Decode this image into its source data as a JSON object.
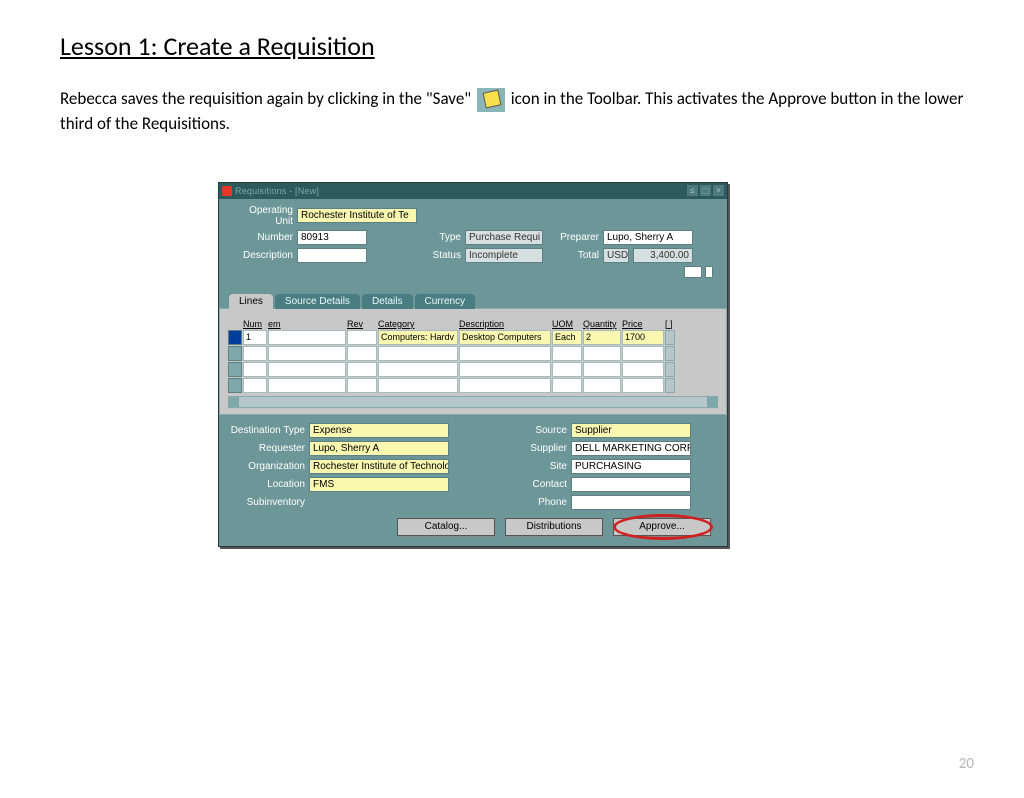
{
  "page": {
    "title": "Lesson 1:  Create a Requisition",
    "body_pre": "Rebecca saves the requisition again by clicking in the \"Save\" ",
    "body_post": " icon in the Toolbar.  This activates the Approve button in the lower third of the Requisitions.",
    "page_number": "20"
  },
  "window": {
    "title": "Requisitions - [New]"
  },
  "header": {
    "labels": {
      "operating_unit": "Operating Unit",
      "number": "Number",
      "description": "Description",
      "type": "Type",
      "status": "Status",
      "preparer": "Preparer",
      "total": "Total"
    },
    "operating_unit": "Rochester Institute of Te",
    "number": "80913",
    "description": "",
    "type": "Purchase Requi",
    "status": "Incomplete",
    "preparer": "Lupo, Sherry A",
    "currency": "USD",
    "total": "3,400.00"
  },
  "tabs": [
    "Lines",
    "Source Details",
    "Details",
    "Currency"
  ],
  "grid": {
    "headers": [
      "Num",
      "em",
      "Rev",
      "Category",
      "Description",
      "UOM",
      "Quantity",
      "Price"
    ],
    "row": {
      "num": "1",
      "em": "",
      "rev": "",
      "category": "Computers: Hardv",
      "description": "Desktop Computers",
      "uom": "Each",
      "quantity": "2",
      "price": "1700"
    }
  },
  "lower": {
    "labels": {
      "dest_type": "Destination Type",
      "requester": "Requester",
      "organization": "Organization",
      "location": "Location",
      "subinventory": "Subinventory",
      "source": "Source",
      "supplier": "Supplier",
      "site": "Site",
      "contact": "Contact",
      "phone": "Phone"
    },
    "dest_type": "Expense",
    "requester": "Lupo, Sherry A",
    "organization": "Rochester Institute of Technolog",
    "location": "FMS",
    "subinventory": "",
    "source": "Supplier",
    "supplier": "DELL MARKETING CORP",
    "site": "PURCHASING",
    "contact": "",
    "phone": ""
  },
  "buttons": {
    "catalog": "Catalog...",
    "distributions": "Distributions",
    "approve": "Approve..."
  }
}
